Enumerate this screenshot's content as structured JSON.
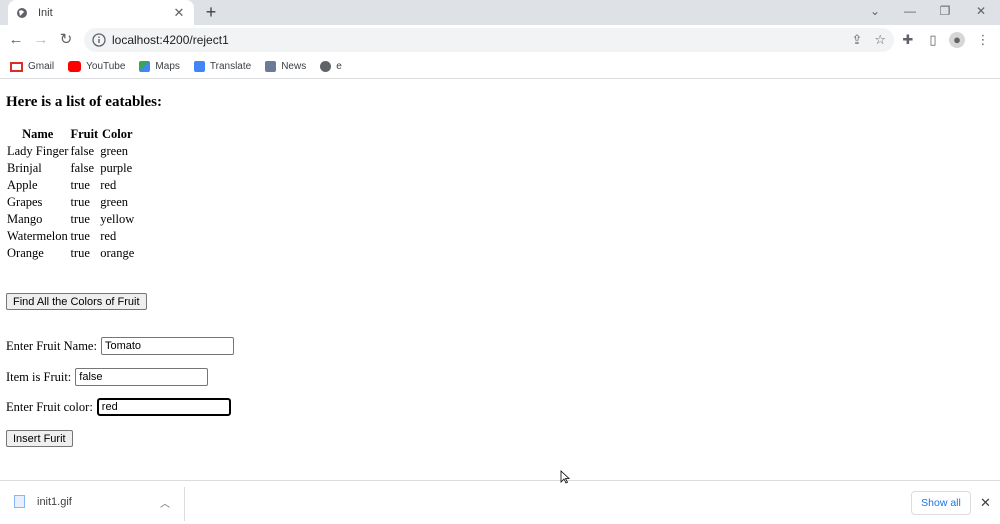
{
  "browser": {
    "tab_title": "Init",
    "tab_close": "✕",
    "new_tab": "+",
    "address": "localhost:4200/reject1",
    "bookmarks": [
      {
        "label": "Gmail",
        "icon": "gmail-icon",
        "color": "#d93025"
      },
      {
        "label": "YouTube",
        "icon": "youtube-icon",
        "color": "#ff0000"
      },
      {
        "label": "Maps",
        "icon": "maps-icon",
        "color": "#34a853"
      },
      {
        "label": "Translate",
        "icon": "translate-icon",
        "color": "#4285f4"
      },
      {
        "label": "News",
        "icon": "news-icon",
        "color": "#5f6368"
      },
      {
        "label": "e",
        "icon": "globe-icon",
        "color": "#5f6368"
      }
    ]
  },
  "page": {
    "heading": "Here is a list of eatables:",
    "table": {
      "headers": [
        "Name",
        "Fruit",
        "Color"
      ],
      "rows": [
        [
          "Lady Finger",
          "false",
          "green"
        ],
        [
          "Brinjal",
          "false",
          "purple"
        ],
        [
          "Apple",
          "true",
          "red"
        ],
        [
          "Grapes",
          "true",
          "green"
        ],
        [
          "Mango",
          "true",
          "yellow"
        ],
        [
          "Watermelon",
          "true",
          "red"
        ],
        [
          "Orange",
          "true",
          "orange"
        ]
      ]
    },
    "find_button": "Find All the Colors of Fruit",
    "form": {
      "name_label": "Enter Fruit Name:",
      "name_value": "Tomato",
      "isfruit_label": "Item is Fruit:",
      "isfruit_value": "false",
      "color_label": "Enter Fruit color:",
      "color_value": "red",
      "insert_button": "Insert Furit"
    }
  },
  "downloads": {
    "file_name": "init1.gif",
    "show_all": "Show all"
  }
}
